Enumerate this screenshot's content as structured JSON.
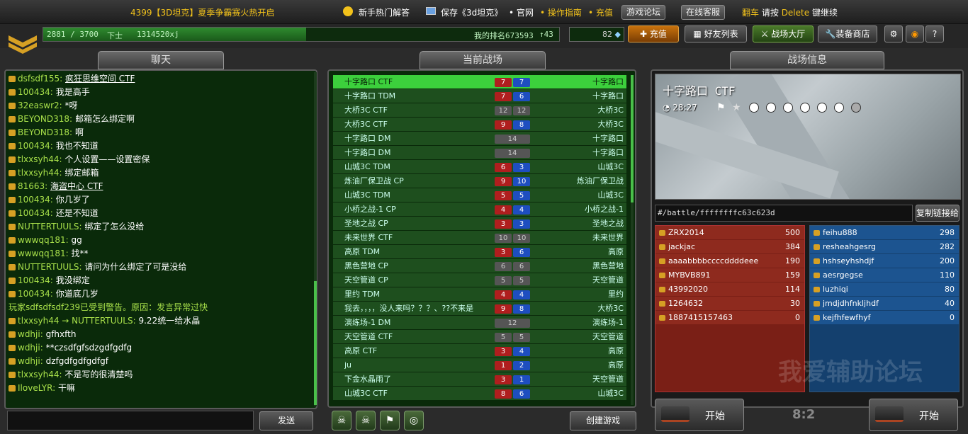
{
  "topbar": {
    "banner": "4399【3D坦克】夏季争霸赛火热开启",
    "faq": "新手热门解答",
    "save": "保存《3d坦克》",
    "official": "• 官网",
    "guide": "• 操作指南",
    "recharge_link": "• 充值",
    "forum": "游戏论坛",
    "support": "在线客服",
    "flip_tip_prefix": "翻车",
    "flip_tip": "请按",
    "flip_key": "Delete",
    "flip_tip_suffix": "键继续"
  },
  "player": {
    "xp": "2881 / 3700",
    "rank_name": "下士",
    "username": "1314520xj",
    "xp_progress": 0.51,
    "ranking": "我的排名673593",
    "rank_change": "↑43",
    "crystals": "82"
  },
  "nav": {
    "recharge": "充值",
    "friends": "好友列表",
    "lobby": "战场大厅",
    "shop": "装备商店",
    "help": "?"
  },
  "headers": {
    "chat": "聊天",
    "battles": "当前战场",
    "info": "战场信息"
  },
  "chat": {
    "send": "发送",
    "lines": [
      {
        "name": "dsfsdf155:",
        "text": "疯狂思维空间 CTF",
        "link": true
      },
      {
        "name": "100434:",
        "text": "我是高手"
      },
      {
        "name": "32easwr2:",
        "text": "*呀"
      },
      {
        "name": "BEYOND318:",
        "text": "邮箱怎么绑定啊"
      },
      {
        "name": "BEYOND318:",
        "text": "啊"
      },
      {
        "name": "100434:",
        "text": "我也不知道"
      },
      {
        "name": "tlxxsyh44:",
        "text": "个人设置——设置密保"
      },
      {
        "name": "tlxxsyh44:",
        "text": "绑定邮箱"
      },
      {
        "name": "81663:",
        "text": "海盗中心 CTF",
        "link": true
      },
      {
        "name": "100434:",
        "text": "你几岁了"
      },
      {
        "name": "100434:",
        "text": "还是不知道"
      },
      {
        "name": "NUTTERTUULS:",
        "text": "绑定了怎么没给"
      },
      {
        "name": "wwwqq181:",
        "text": "gg"
      },
      {
        "name": "wwwqq181:",
        "text": "找**"
      },
      {
        "name": "NUTTERTUULS:",
        "text": "请问为什么绑定了可是没给"
      },
      {
        "name": "100434:",
        "text": "我没绑定"
      },
      {
        "name": "100434:",
        "text": "你道底几岁"
      },
      {
        "system": "玩家sdfsdfsdf239已受到警告。原因：发言异常过快"
      },
      {
        "name": "tlxxsyh44 → NUTTERTUULS:",
        "text": "9.22统一给水晶"
      },
      {
        "name": "wdhji:",
        "text": "gfhxfth"
      },
      {
        "name": "wdhji:",
        "text": "**czsdfgfsdzgdfgdfg"
      },
      {
        "name": "wdhji:",
        "text": "dzfgdfgdfgdfgf"
      },
      {
        "name": "tlxxsyh44:",
        "text": "不是写的很清楚吗"
      },
      {
        "name": "IloveLYR:",
        "text": "干嘛"
      }
    ]
  },
  "battles": {
    "create": "创建游戏",
    "rows": [
      {
        "name": "十字路口 CTF",
        "map": "十字路口",
        "red": "7",
        "blue": "7",
        "mode": "team",
        "selected": true
      },
      {
        "name": "十字路口 TDM",
        "map": "十字路口",
        "red": "7",
        "blue": "6",
        "mode": "team"
      },
      {
        "name": "大桥3C CTF",
        "map": "大桥3C",
        "red": "12",
        "blue": "12",
        "mode": "full"
      },
      {
        "name": "大桥3C CTF",
        "map": "大桥3C",
        "red": "9",
        "blue": "8",
        "mode": "team"
      },
      {
        "name": "十字路口 DM",
        "map": "十字路口",
        "total": "14",
        "mode": "dm"
      },
      {
        "name": "十字路口 DM",
        "map": "十字路口",
        "total": "14",
        "mode": "dm"
      },
      {
        "name": "山城3C TDM",
        "map": "山城3C",
        "red": "6",
        "blue": "3",
        "mode": "team"
      },
      {
        "name": "炼油厂保卫战 CP",
        "map": "炼油厂保卫战",
        "red": "9",
        "blue": "10",
        "mode": "team"
      },
      {
        "name": "山城3C TDM",
        "map": "山城3C",
        "red": "5",
        "blue": "5",
        "mode": "team"
      },
      {
        "name": "小桥之战-1 CP",
        "map": "小桥之战-1",
        "red": "4",
        "blue": "4",
        "mode": "team"
      },
      {
        "name": "圣地之战 CP",
        "map": "圣地之战",
        "red": "3",
        "blue": "3",
        "mode": "team"
      },
      {
        "name": "未来世界 CTF",
        "map": "未来世界",
        "red": "10",
        "blue": "10",
        "mode": "full"
      },
      {
        "name": "高原 TDM",
        "map": "高原",
        "red": "3",
        "blue": "6",
        "mode": "team"
      },
      {
        "name": "黑色营地 CP",
        "map": "黑色营地",
        "red": "6",
        "blue": "6",
        "mode": "full"
      },
      {
        "name": "天空管道 CP",
        "map": "天空管道",
        "red": "5",
        "blue": "5",
        "mode": "full"
      },
      {
        "name": "里约 TDM",
        "map": "里约",
        "red": "4",
        "blue": "4",
        "mode": "team"
      },
      {
        "name": "我去，，，，没人来吗？？？、??不来是",
        "map": "大桥3C",
        "red": "9",
        "blue": "8",
        "mode": "team"
      },
      {
        "name": "演练场-1 DM",
        "map": "演练场-1",
        "total": "12",
        "mode": "dm"
      },
      {
        "name": "天空管道 CTF",
        "map": "天空管道",
        "red": "5",
        "blue": "5",
        "mode": "full"
      },
      {
        "name": "高原 CTF",
        "map": "高原",
        "red": "3",
        "blue": "4",
        "mode": "team"
      },
      {
        "name": "ju",
        "map": "高原",
        "red": "1",
        "blue": "2",
        "mode": "team"
      },
      {
        "name": "下金水晶雨了",
        "map": "天空管道",
        "red": "3",
        "blue": "1",
        "mode": "team"
      },
      {
        "name": "山城3C CTF",
        "map": "山城3C",
        "red": "8",
        "blue": "6",
        "mode": "team"
      }
    ]
  },
  "info": {
    "map_title": "十字路口 CTF",
    "time": "28:27",
    "url": "#/battle/ffffffffc63c623d",
    "copy": "复制链接给",
    "red": [
      {
        "name": "ZRX2014",
        "score": "500"
      },
      {
        "name": "jackjac",
        "score": "384"
      },
      {
        "name": "aaaabbbbccccddddeee",
        "score": "190"
      },
      {
        "name": "MYBVB891",
        "score": "159"
      },
      {
        "name": "43992020",
        "score": "114"
      },
      {
        "name": "1264632",
        "score": "30"
      },
      {
        "name": "1887415157463",
        "score": "0"
      }
    ],
    "blue": [
      {
        "name": "feihu888",
        "score": "298"
      },
      {
        "name": "resheahgesrg",
        "score": "282"
      },
      {
        "name": "hshseyhshdjf",
        "score": "200"
      },
      {
        "name": "aesrgegse",
        "score": "110"
      },
      {
        "name": "luzhiqi",
        "score": "80"
      },
      {
        "name": "jmdjdhfnkljhdf",
        "score": "40"
      },
      {
        "name": "kejfhfewfhyf",
        "score": "0"
      }
    ],
    "start": "开始",
    "score": "8:2",
    "watermark": "我爱辅助论坛"
  }
}
